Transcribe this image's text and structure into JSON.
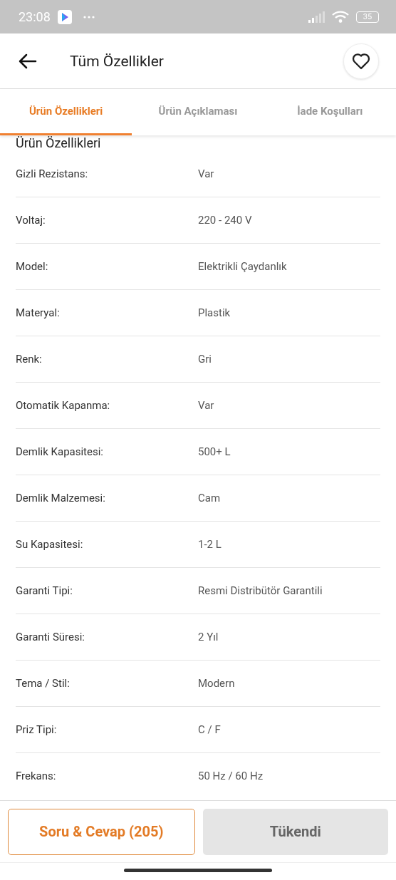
{
  "status_bar": {
    "time": "23:08",
    "battery": "35"
  },
  "header": {
    "title": "Tüm Özellikler"
  },
  "tabs": [
    {
      "label": "Ürün Özellikleri",
      "selected": true
    },
    {
      "label": "Ürün Açıklaması",
      "selected": false
    },
    {
      "label": "İade Koşulları",
      "selected": false
    }
  ],
  "section_title": "Ürün Özellikleri",
  "specs": [
    {
      "name": "Gizli Rezistans:",
      "value": "Var"
    },
    {
      "name": "Voltaj:",
      "value": "220 - 240 V"
    },
    {
      "name": "Model:",
      "value": "Elektrikli Çaydanlık"
    },
    {
      "name": "Materyal:",
      "value": "Plastik"
    },
    {
      "name": "Renk:",
      "value": "Gri"
    },
    {
      "name": "Otomatik Kapanma:",
      "value": "Var"
    },
    {
      "name": "Demlik Kapasitesi:",
      "value": "500+ L"
    },
    {
      "name": "Demlik Malzemesi:",
      "value": "Cam"
    },
    {
      "name": "Su Kapasitesi:",
      "value": "1-2 L"
    },
    {
      "name": "Garanti Tipi:",
      "value": "Resmi Distribütör Garantili"
    },
    {
      "name": "Garanti Süresi:",
      "value": "2 Yıl"
    },
    {
      "name": "Tema / Stil:",
      "value": "Modern"
    },
    {
      "name": "Priz Tipi:",
      "value": "C / F"
    },
    {
      "name": "Frekans:",
      "value": "50 Hz / 60 Hz"
    }
  ],
  "buttons": [
    {
      "label": "Soru & Cevap (205)",
      "kind": "outline",
      "disabled": false
    },
    {
      "label": "Tükendi",
      "kind": "filled",
      "disabled": true
    }
  ]
}
